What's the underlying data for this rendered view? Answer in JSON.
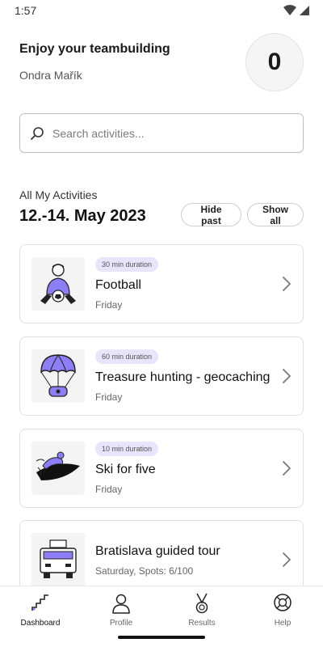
{
  "status_bar": {
    "time": "1:57"
  },
  "header": {
    "greeting": "Enjoy your teambuilding",
    "user_name": "Ondra Mařík",
    "score": "0"
  },
  "search": {
    "placeholder": "Search activities..."
  },
  "activities": {
    "section_label": "All My Activities",
    "date_range": "12.-14. May 2023",
    "hide_past_label": "Hide past",
    "show_all_label": "Show all",
    "items": [
      {
        "duration": "30 min duration",
        "title": "Football",
        "subtitle": "Friday",
        "icon": "football-player-icon"
      },
      {
        "duration": "60 min duration",
        "title": "Treasure hunting - geocaching",
        "subtitle": "Friday",
        "icon": "parachute-chest-icon"
      },
      {
        "duration": "10 min duration",
        "title": "Ski for five",
        "subtitle": "Friday",
        "icon": "skier-icon"
      },
      {
        "duration": "",
        "title": "Bratislava guided tour",
        "subtitle": "Saturday, Spots: 6/100",
        "icon": "tour-bus-icon"
      }
    ]
  },
  "bottom_nav": {
    "items": [
      {
        "label": "Dashboard",
        "icon": "stairs-chart-icon",
        "active": true
      },
      {
        "label": "Profile",
        "icon": "profile-person-icon",
        "active": false
      },
      {
        "label": "Results",
        "icon": "medal-icon",
        "active": false
      },
      {
        "label": "Help",
        "icon": "lifebuoy-icon",
        "active": false
      }
    ]
  },
  "colors": {
    "accent_purple": "#8c7ef5",
    "badge_bg": "#e8e4fb",
    "border": "#e0e0e0"
  }
}
